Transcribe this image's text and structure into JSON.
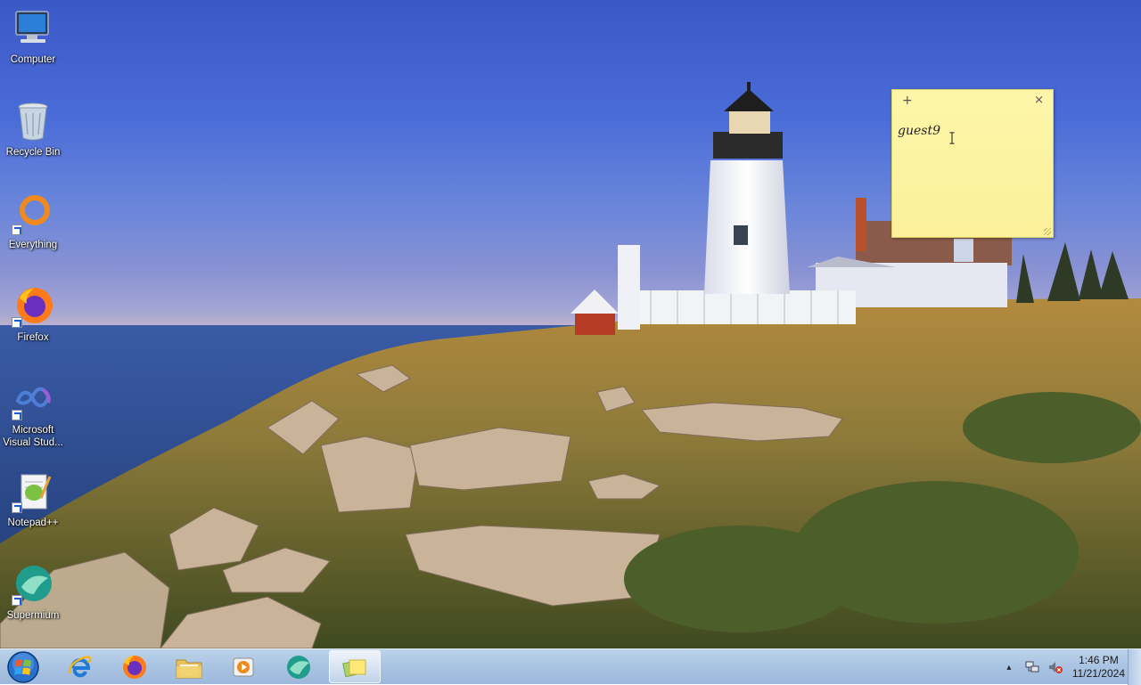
{
  "desktop": {
    "icons": [
      {
        "label": "Computer",
        "icon": "computer-icon"
      },
      {
        "label": "Recycle Bin",
        "icon": "recycle-bin-icon"
      },
      {
        "label": "Everything",
        "icon": "everything-icon"
      },
      {
        "label": "Firefox",
        "icon": "firefox-icon"
      },
      {
        "label": "Microsoft Visual Stud...",
        "icon": "visual-studio-icon"
      },
      {
        "label": "Notepad++",
        "icon": "notepadpp-icon"
      },
      {
        "label": "Supermium",
        "icon": "supermium-icon"
      }
    ]
  },
  "sticky_note": {
    "add_symbol": "+",
    "close_symbol": "×",
    "text": "guest9",
    "color": "#fcf09a"
  },
  "taskbar": {
    "start_icon": "windows-start-icon",
    "pinned": [
      {
        "name": "internet-explorer",
        "icon": "ie-icon"
      },
      {
        "name": "firefox",
        "icon": "firefox-icon"
      },
      {
        "name": "file-explorer",
        "icon": "folder-icon"
      },
      {
        "name": "media-player",
        "icon": "media-player-icon"
      },
      {
        "name": "supermium",
        "icon": "supermium-icon"
      },
      {
        "name": "sticky-notes",
        "icon": "sticky-notes-icon",
        "active": true
      }
    ],
    "tray": {
      "show_hidden": "▴",
      "time": "1:46 PM",
      "date": "11/21/2024"
    }
  }
}
